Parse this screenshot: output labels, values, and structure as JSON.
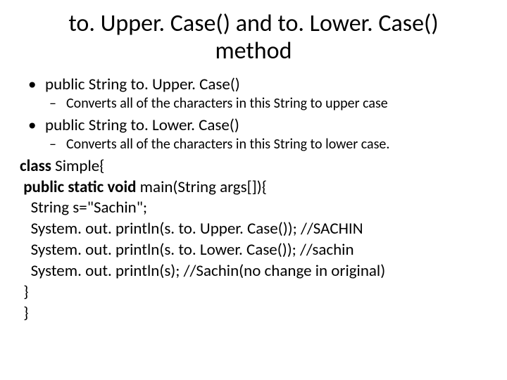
{
  "title": "to. Upper. Case() and to. Lower. Case() method",
  "bullets": {
    "b1": "public String to. Upper. Case()",
    "b1s": "Converts all of the characters in this String to upper case",
    "b2": "public String to. Lower. Case()",
    "b2s": "Converts all of the characters in this String to lower case."
  },
  "code": {
    "l1a": "class",
    "l1b": " Simple{",
    "l2a": " public static void",
    "l2b": " main(String args[]){",
    "l3": "",
    "l4": "   String s=\"Sachin\";",
    "l5": "   System. out. println(s. to. Upper. Case()); //SACHIN",
    "l6": "   System. out. println(s. to. Lower. Case()); //sachin",
    "l7": "   System. out. println(s); //Sachin(no change in original)",
    "l8": " }",
    "l9": " }"
  }
}
